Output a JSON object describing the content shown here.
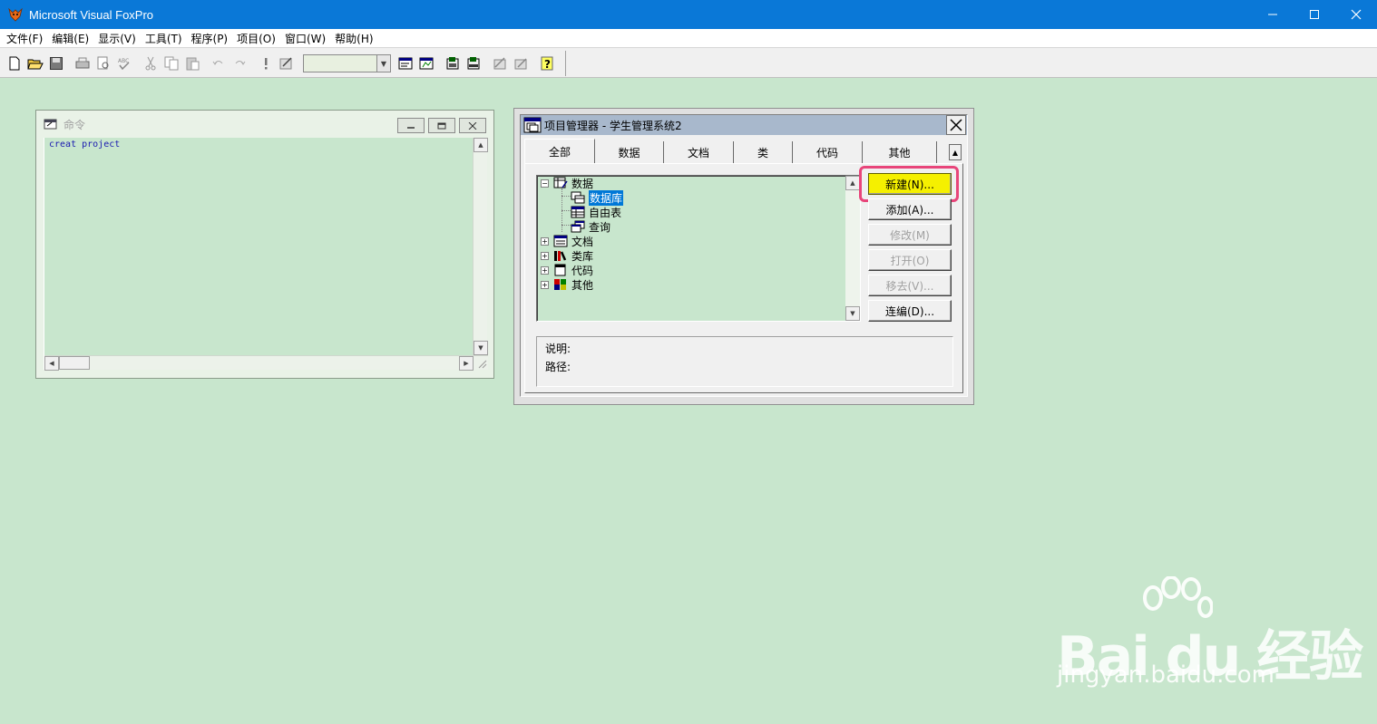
{
  "app": {
    "title": "Microsoft Visual FoxPro",
    "controls": {
      "minimize": "—",
      "maximize": "☐",
      "close": "✕"
    }
  },
  "menu": [
    "文件(F)",
    "编辑(E)",
    "显示(V)",
    "工具(T)",
    "程序(P)",
    "项目(O)",
    "窗口(W)",
    "帮助(H)"
  ],
  "toolbar": {
    "buttons": [
      "new-icon",
      "open-icon",
      "save-icon",
      "print-icon",
      "print-preview-icon",
      "spell-check-icon",
      "cut-icon",
      "copy-icon",
      "paste-icon",
      "undo-icon",
      "redo-icon",
      "run-icon",
      "modify-form-icon",
      "command-window-icon",
      "data-session-icon",
      "form-designer-icon",
      "report-designer-icon",
      "form-wizard-icon",
      "report-wizard-icon",
      "help-icon"
    ],
    "combo_value": ""
  },
  "command_window": {
    "title": "命令",
    "text": "creat project"
  },
  "project_manager": {
    "title": "项目管理器 - 学生管理系统2",
    "tabs": [
      "全部",
      "数据",
      "文档",
      "类",
      "代码",
      "其他"
    ],
    "active_tab": "全部",
    "tree": {
      "data": "数据",
      "database": "数据库",
      "free_table": "自由表",
      "query": "查询",
      "documents": "文档",
      "class_lib": "类库",
      "code": "代码",
      "other": "其他"
    },
    "buttons": {
      "new": "新建(N)...",
      "add": "添加(A)...",
      "modify": "修改(M)",
      "open": "打开(O)",
      "remove": "移去(V)...",
      "build": "连编(D)..."
    },
    "desc_label": "说明:",
    "path_label": "路径:"
  },
  "watermark": {
    "logo": "Bai du 经验",
    "url": "jingyan.baidu.com"
  },
  "colors": {
    "titlebar": "#0a78d7",
    "desktop": "#c8e6cd",
    "highlight_button": "#f5f000",
    "highlight_ring": "#e8457a",
    "selection": "#0078d7"
  }
}
